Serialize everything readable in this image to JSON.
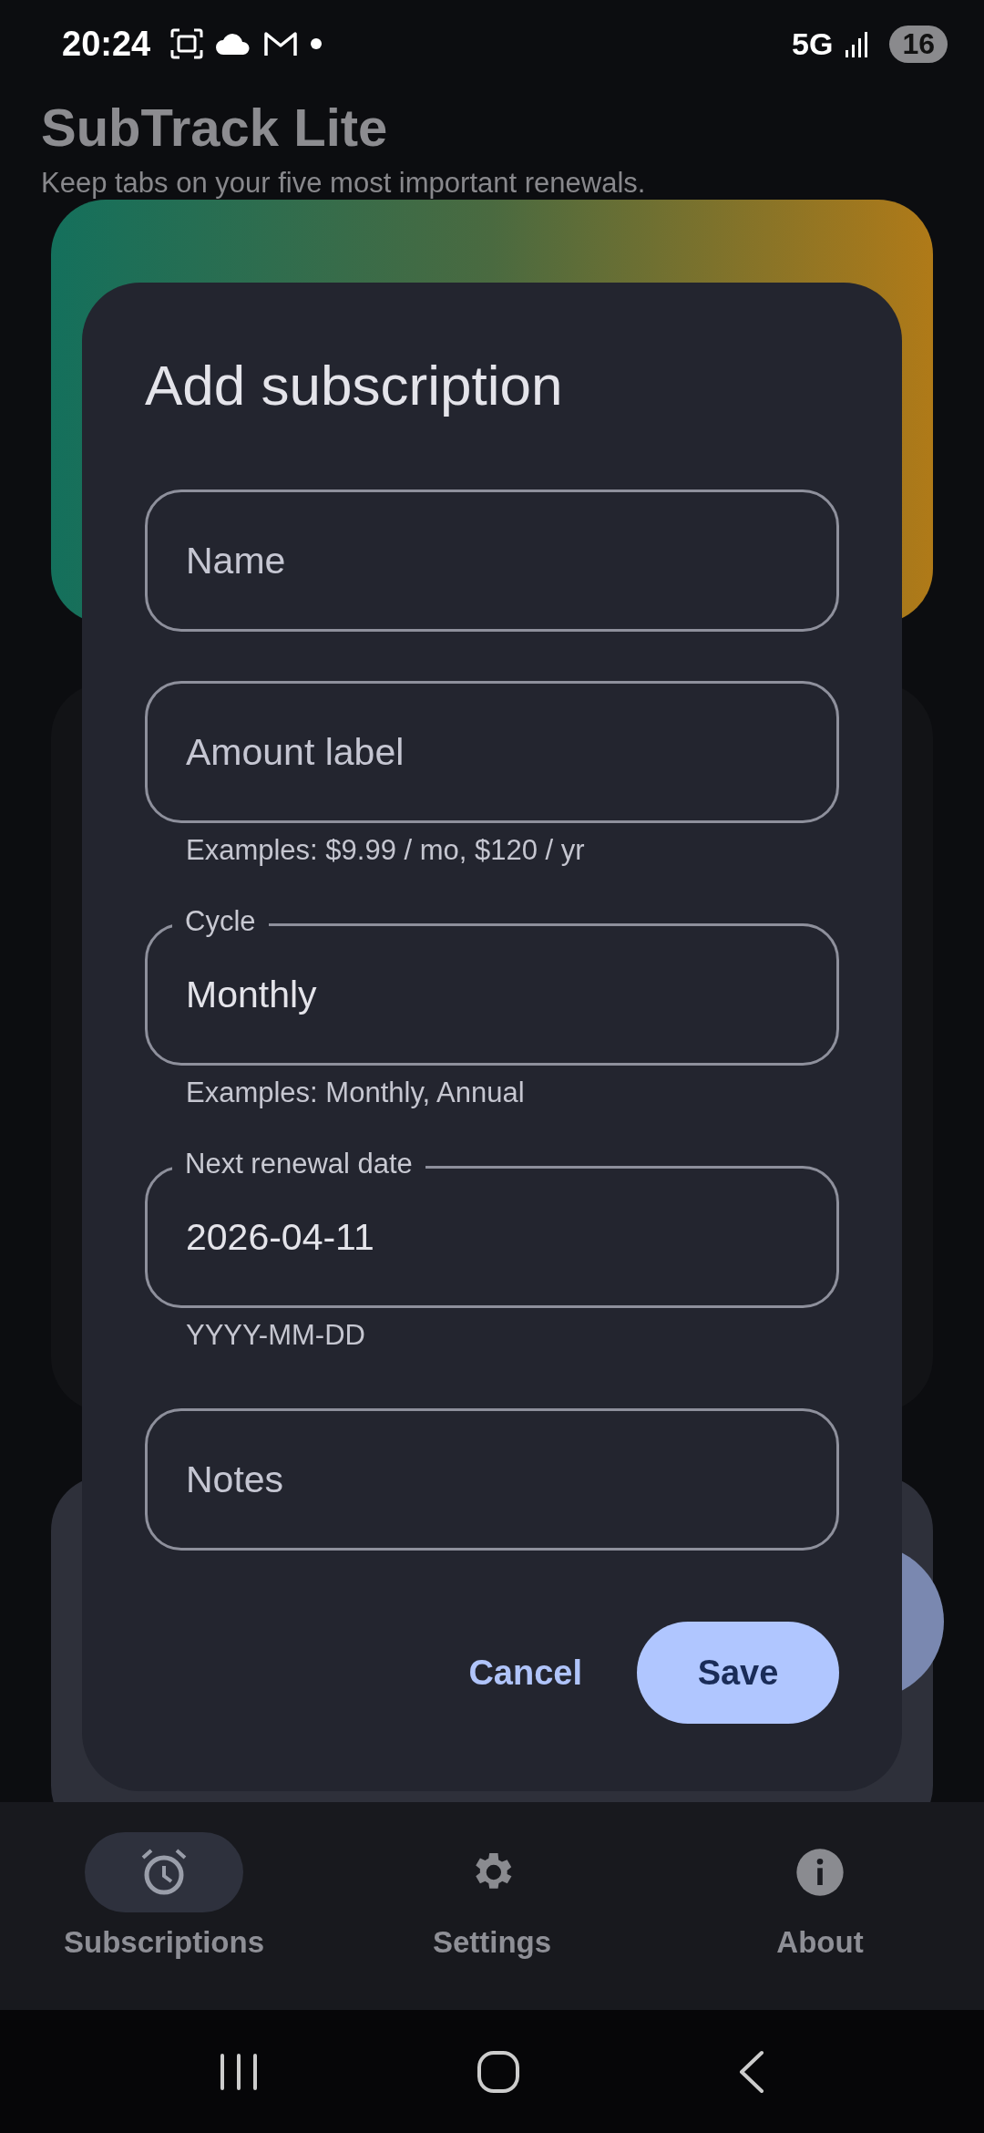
{
  "status_bar": {
    "time": "20:24",
    "network": "5G",
    "battery": "16"
  },
  "app": {
    "title": "SubTrack Lite",
    "subtitle": "Keep tabs on your five most important renewals."
  },
  "dialog": {
    "title": "Add subscription",
    "fields": [
      {
        "placeholder": "Name"
      },
      {
        "placeholder": "Amount label",
        "helper": "Examples: $9.99 / mo, $120 / yr"
      },
      {
        "label": "Cycle",
        "value": "Monthly",
        "helper": "Examples: Monthly, Annual"
      },
      {
        "label": "Next renewal date",
        "value": "2026-04-11",
        "helper": "YYYY-MM-DD"
      },
      {
        "placeholder": "Notes"
      }
    ],
    "buttons": [
      {
        "kind": "text",
        "label": "Cancel"
      },
      {
        "kind": "filled",
        "label": "Save"
      }
    ]
  },
  "nav": [
    {
      "label": "Subscriptions",
      "selected": true
    },
    {
      "label": "Settings",
      "selected": false
    },
    {
      "label": "About",
      "selected": false
    }
  ]
}
